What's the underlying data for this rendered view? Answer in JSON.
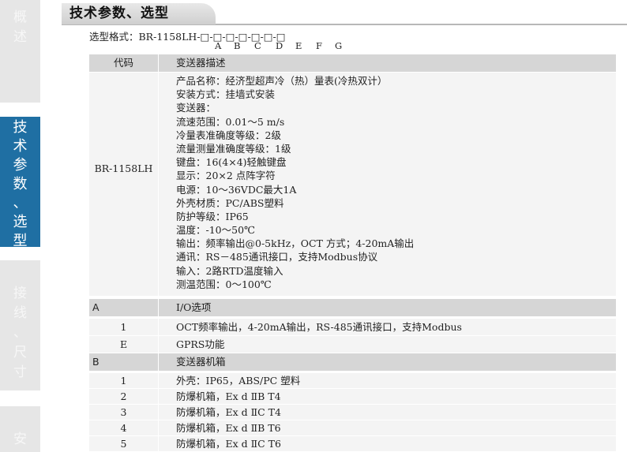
{
  "sidebar": {
    "items": [
      {
        "label": "概述",
        "chars": [
          "概",
          "述"
        ],
        "active": false
      },
      {
        "label": "技术参数、选型",
        "chars": [
          "技",
          "术",
          "参",
          "数",
          "、",
          "选",
          "型"
        ],
        "active": true
      },
      {
        "label": "接线、尺寸",
        "chars": [
          "接",
          "线",
          "、",
          "尺",
          "寸"
        ],
        "active": false
      },
      {
        "label": "安",
        "chars": [
          "安"
        ],
        "active": false
      }
    ]
  },
  "section_title": "技术参数、选型",
  "format_line": "选型格式：BR-1158LH-□-□-□-□-□-□-□",
  "format_letters": [
    "A",
    "B",
    "C",
    "D",
    "E",
    "F",
    "G"
  ],
  "table": {
    "header": {
      "code": "代码",
      "desc": "变送器描述"
    },
    "model": "BR-1158LH",
    "spec_lines": [
      "产品名称：经济型超声冷（热）量表(冷热双计）",
      "安装方式：挂墙式安装",
      "变送器：",
      "流速范围：0.01～5 m/s",
      "冷量表准确度等级：2级",
      "流量测量准确度等级：1级",
      "键盘：16(4×4)轻触键盘",
      "显示：20×2 点阵字符",
      "电源：10～36VDC最大1A",
      "外壳材质：PC/ABS塑料",
      "防护等级：IP65",
      "温度：-10～50℃",
      "输出：频率输出@0-5kHz，OCT 方式；4-20mA输出",
      "通讯：RS－485通讯接口，支持Modbus协议",
      "输入：2路RTD温度输入",
      "测温范围：0～100℃"
    ],
    "section_a": {
      "letter": "A",
      "title": "I/O选项",
      "rows": [
        {
          "code": "1",
          "desc": "OCT频率输出，4-20mA输出，RS-485通讯接口，支持Modbus"
        },
        {
          "code": "E",
          "desc": "GPRS功能"
        }
      ]
    },
    "section_b": {
      "letter": "B",
      "title": "变送器机箱",
      "rows": [
        {
          "code": "1",
          "desc": "外壳：IP65，ABS/PC 塑料"
        },
        {
          "code": "2",
          "desc": "防爆机箱，Ex d ⅡB T4"
        },
        {
          "code": "3",
          "desc": "防爆机箱，Ex d ⅡC T4"
        },
        {
          "code": "4",
          "desc": "防爆机箱，Ex d ⅡB T6"
        },
        {
          "code": "5",
          "desc": "防爆机箱，Ex d ⅡC T6"
        }
      ]
    }
  },
  "colors": {
    "active_tab": "#1f6fa3",
    "inactive_tab": "#e6e6e6",
    "header_row": "#d6d6d6",
    "body_row": "#f4f4f4"
  }
}
